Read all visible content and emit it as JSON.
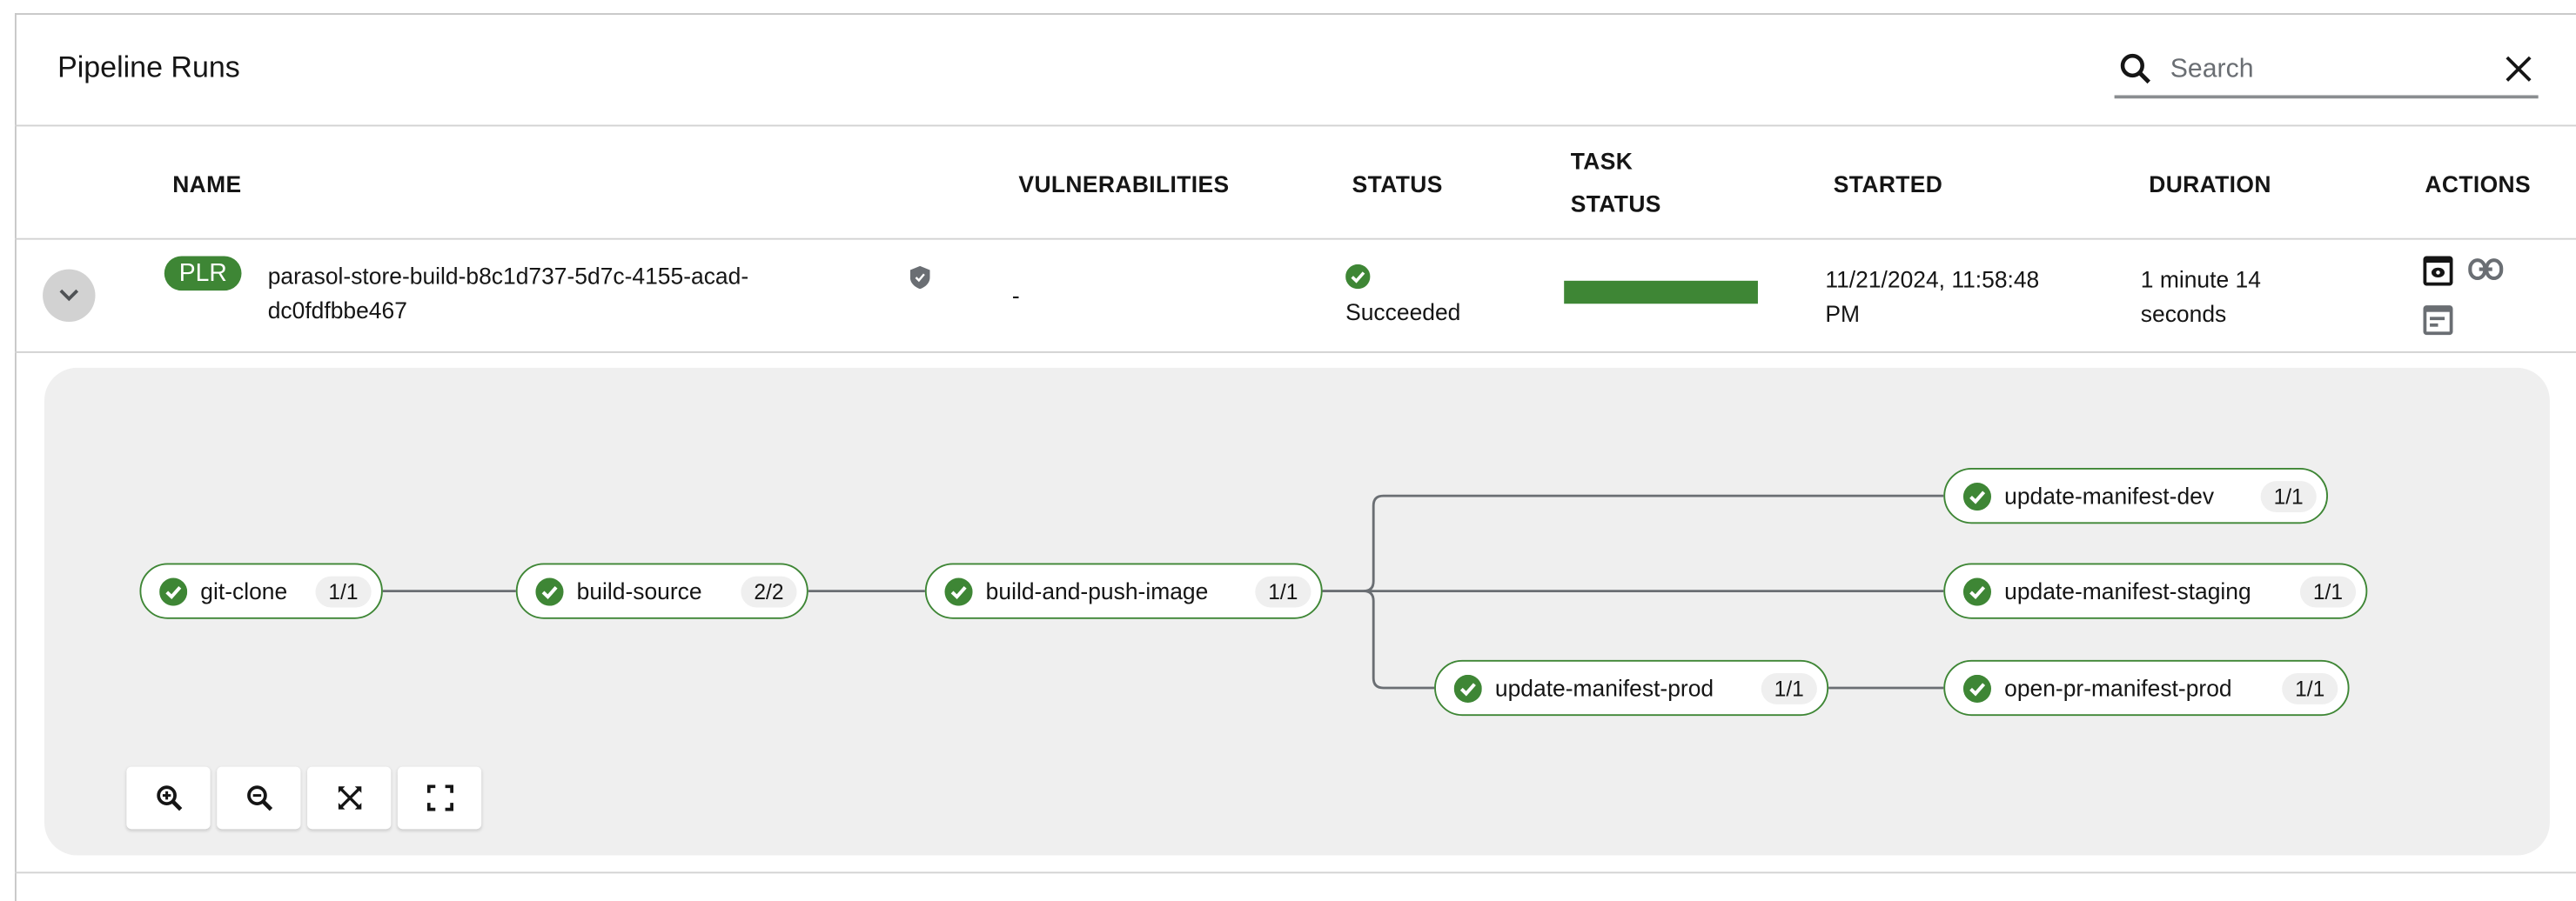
{
  "header": {
    "title": "Pipeline Runs",
    "search": {
      "placeholder": "Search",
      "value": ""
    }
  },
  "table": {
    "columns": [
      "NAME",
      "VULNERABILITIES",
      "STATUS",
      "TASK",
      "STATUS",
      "STARTED",
      "DURATION",
      "ACTIONS"
    ],
    "rows": [
      {
        "badge": "PLR",
        "name_line1": "parasol-store-build-b8c1d737-5d7c-4155-acad-",
        "name_line2": "dc0fdfbbe467",
        "vulnerabilities": "-",
        "status": "Succeeded",
        "task_status_succeeded_percent": 100,
        "started_line1": "11/21/2024, 11:58:48",
        "started_line2": "PM",
        "duration_line1": "1 minute 14",
        "duration_line2": "seconds",
        "actions": [
          "view-logs-icon",
          "link-icon",
          "summary-icon"
        ]
      }
    ]
  },
  "graph": {
    "nodes": [
      {
        "name": "git-clone",
        "count": "1/1",
        "status": "succeeded"
      },
      {
        "name": "build-source",
        "count": "2/2",
        "status": "succeeded"
      },
      {
        "name": "build-and-push-image",
        "count": "1/1",
        "status": "succeeded"
      },
      {
        "name": "update-manifest-dev",
        "count": "1/1",
        "status": "succeeded"
      },
      {
        "name": "update-manifest-staging",
        "count": "1/1",
        "status": "succeeded"
      },
      {
        "name": "update-manifest-prod",
        "count": "1/1",
        "status": "succeeded"
      },
      {
        "name": "open-pr-manifest-prod",
        "count": "1/1",
        "status": "succeeded"
      }
    ],
    "edges": [
      [
        "git-clone",
        "build-source"
      ],
      [
        "build-source",
        "build-and-push-image"
      ],
      [
        "build-and-push-image",
        "update-manifest-dev"
      ],
      [
        "build-and-push-image",
        "update-manifest-staging"
      ],
      [
        "build-and-push-image",
        "update-manifest-prod"
      ],
      [
        "update-manifest-prod",
        "open-pr-manifest-prod"
      ]
    ],
    "controls": [
      "zoom-in",
      "zoom-out",
      "fit-to-screen",
      "reset-view"
    ]
  },
  "colors": {
    "success": "#3e8635",
    "panel": "#efefef",
    "edge": "#6a6e73"
  }
}
